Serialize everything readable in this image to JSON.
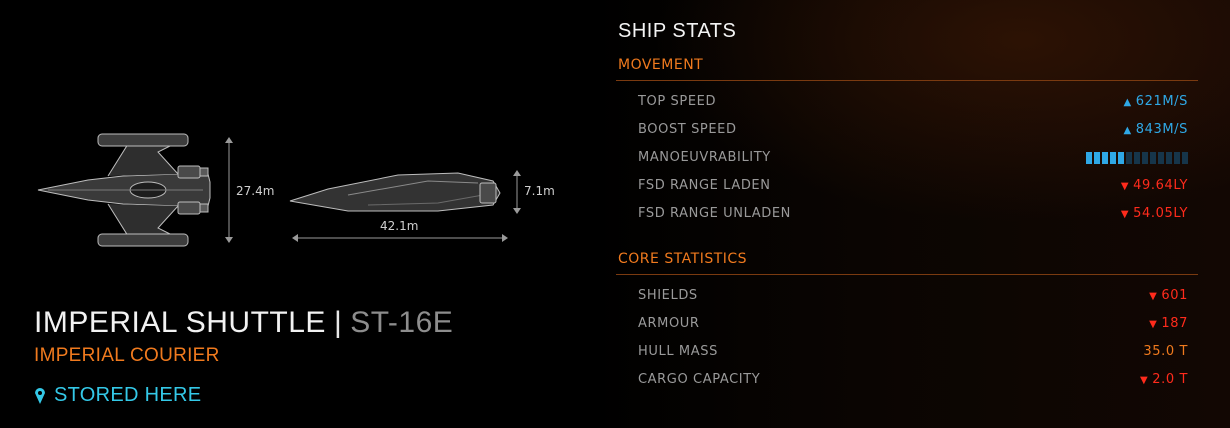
{
  "ship": {
    "name": "IMPERIAL SHUTTLE",
    "separator": "|",
    "id": "ST-16E",
    "role": "IMPERIAL COURIER",
    "status": "STORED HERE"
  },
  "dimensions": {
    "width": "27.4m",
    "length": "42.1m",
    "height": "7.1m"
  },
  "stats": {
    "title": "SHIP STATS",
    "movement": {
      "header": "MOVEMENT",
      "top_speed": {
        "label": "TOP SPEED",
        "value": "621M/S",
        "trend": "up"
      },
      "boost_speed": {
        "label": "BOOST SPEED",
        "value": "843M/S",
        "trend": "up"
      },
      "manoeuvrability": {
        "label": "MANOEUVRABILITY",
        "level": 5,
        "max": 13
      },
      "fsd_laden": {
        "label": "FSD RANGE LADEN",
        "value": "49.64LY",
        "trend": "down"
      },
      "fsd_unladen": {
        "label": "FSD RANGE UNLADEN",
        "value": "54.05LY",
        "trend": "down"
      }
    },
    "core": {
      "header": "CORE STATISTICS",
      "shields": {
        "label": "SHIELDS",
        "value": "601",
        "trend": "down"
      },
      "armour": {
        "label": "ARMOUR",
        "value": "187",
        "trend": "down"
      },
      "hull_mass": {
        "label": "HULL MASS",
        "value": "35.0 T",
        "trend": "neutral"
      },
      "cargo": {
        "label": "CARGO CAPACITY",
        "value": "2.0 T",
        "trend": "down"
      }
    }
  },
  "colors": {
    "accent": "#f07a1e",
    "increase": "#2fa8e6",
    "decrease": "#ff2b1c",
    "stored": "#34c9e8"
  },
  "icons": {
    "up": "▲",
    "down": "▼",
    "stored": "location-marker-icon"
  }
}
